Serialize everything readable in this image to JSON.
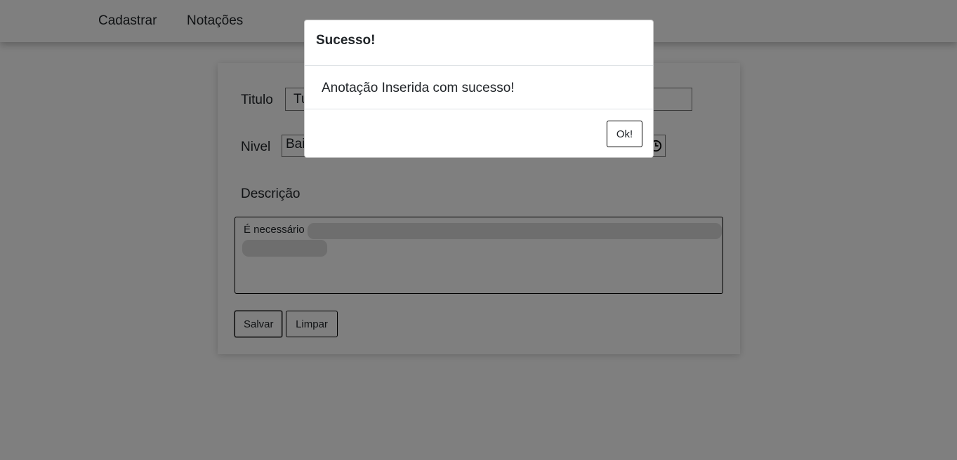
{
  "navbar": {
    "items": [
      {
        "label": "Cadastrar"
      },
      {
        "label": "Notações"
      }
    ]
  },
  "form": {
    "titulo_label": "Titulo",
    "titulo_value": "Tu                                                          o.",
    "nivel_label": "Nivel",
    "nivel_value": "Bai",
    "nivel_icon": "clock-icon",
    "descricao_label": "Descrição",
    "descricao_value": "É necessário",
    "save_label": "Salvar",
    "clear_label": "Limpar"
  },
  "modal": {
    "title": "Sucesso!",
    "message": "Anotação Inserida com sucesso!",
    "ok_label": "Ok!"
  },
  "colors": {
    "backdrop": "#000000",
    "text": "#212529"
  }
}
